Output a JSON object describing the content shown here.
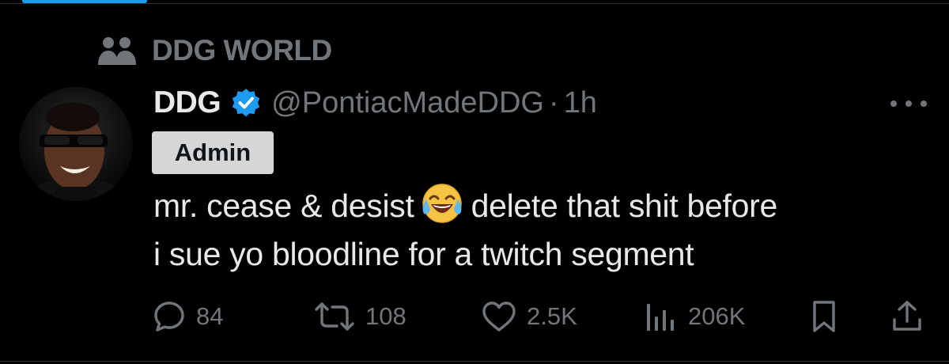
{
  "context": {
    "label": "DDG WORLD",
    "icon": "community-icon"
  },
  "post": {
    "author_name": "DDG",
    "verified_icon": "verified-badge-icon",
    "handle": "@PontiacMadeDDG",
    "separator": "·",
    "time": "1h",
    "role_badge": "Admin",
    "text_line1_a": "mr. cease & desist",
    "emoji": "😂",
    "text_line1_b": "delete that shit before",
    "text_line2": "i sue yo bloodline for a twitch segment"
  },
  "actions": {
    "replies": "84",
    "reposts": "108",
    "likes": "2.5K",
    "views": "206K"
  },
  "colors": {
    "background": "#000000",
    "text_primary": "#e7e9ea",
    "text_secondary": "#71767b",
    "accent": "#1d9bf0",
    "badge_bg": "#d6d6d6"
  }
}
